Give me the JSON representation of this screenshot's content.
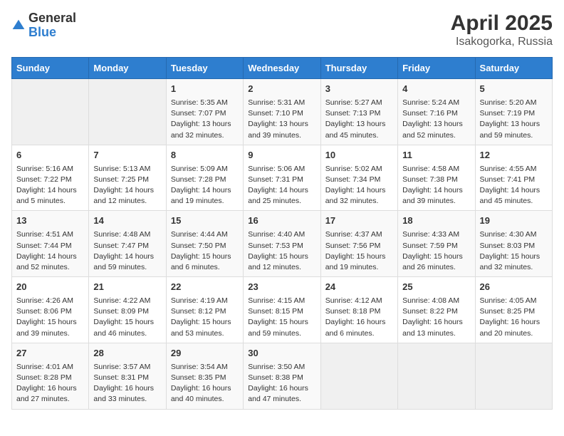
{
  "logo": {
    "general": "General",
    "blue": "Blue"
  },
  "title": {
    "month": "April 2025",
    "location": "Isakogorka, Russia"
  },
  "weekdays": [
    "Sunday",
    "Monday",
    "Tuesday",
    "Wednesday",
    "Thursday",
    "Friday",
    "Saturday"
  ],
  "weeks": [
    [
      null,
      null,
      {
        "day": 1,
        "sunrise": "5:35 AM",
        "sunset": "7:07 PM",
        "daylight": "13 hours and 32 minutes."
      },
      {
        "day": 2,
        "sunrise": "5:31 AM",
        "sunset": "7:10 PM",
        "daylight": "13 hours and 39 minutes."
      },
      {
        "day": 3,
        "sunrise": "5:27 AM",
        "sunset": "7:13 PM",
        "daylight": "13 hours and 45 minutes."
      },
      {
        "day": 4,
        "sunrise": "5:24 AM",
        "sunset": "7:16 PM",
        "daylight": "13 hours and 52 minutes."
      },
      {
        "day": 5,
        "sunrise": "5:20 AM",
        "sunset": "7:19 PM",
        "daylight": "13 hours and 59 minutes."
      }
    ],
    [
      {
        "day": 6,
        "sunrise": "5:16 AM",
        "sunset": "7:22 PM",
        "daylight": "14 hours and 5 minutes."
      },
      {
        "day": 7,
        "sunrise": "5:13 AM",
        "sunset": "7:25 PM",
        "daylight": "14 hours and 12 minutes."
      },
      {
        "day": 8,
        "sunrise": "5:09 AM",
        "sunset": "7:28 PM",
        "daylight": "14 hours and 19 minutes."
      },
      {
        "day": 9,
        "sunrise": "5:06 AM",
        "sunset": "7:31 PM",
        "daylight": "14 hours and 25 minutes."
      },
      {
        "day": 10,
        "sunrise": "5:02 AM",
        "sunset": "7:34 PM",
        "daylight": "14 hours and 32 minutes."
      },
      {
        "day": 11,
        "sunrise": "4:58 AM",
        "sunset": "7:38 PM",
        "daylight": "14 hours and 39 minutes."
      },
      {
        "day": 12,
        "sunrise": "4:55 AM",
        "sunset": "7:41 PM",
        "daylight": "14 hours and 45 minutes."
      }
    ],
    [
      {
        "day": 13,
        "sunrise": "4:51 AM",
        "sunset": "7:44 PM",
        "daylight": "14 hours and 52 minutes."
      },
      {
        "day": 14,
        "sunrise": "4:48 AM",
        "sunset": "7:47 PM",
        "daylight": "14 hours and 59 minutes."
      },
      {
        "day": 15,
        "sunrise": "4:44 AM",
        "sunset": "7:50 PM",
        "daylight": "15 hours and 6 minutes."
      },
      {
        "day": 16,
        "sunrise": "4:40 AM",
        "sunset": "7:53 PM",
        "daylight": "15 hours and 12 minutes."
      },
      {
        "day": 17,
        "sunrise": "4:37 AM",
        "sunset": "7:56 PM",
        "daylight": "15 hours and 19 minutes."
      },
      {
        "day": 18,
        "sunrise": "4:33 AM",
        "sunset": "7:59 PM",
        "daylight": "15 hours and 26 minutes."
      },
      {
        "day": 19,
        "sunrise": "4:30 AM",
        "sunset": "8:03 PM",
        "daylight": "15 hours and 32 minutes."
      }
    ],
    [
      {
        "day": 20,
        "sunrise": "4:26 AM",
        "sunset": "8:06 PM",
        "daylight": "15 hours and 39 minutes."
      },
      {
        "day": 21,
        "sunrise": "4:22 AM",
        "sunset": "8:09 PM",
        "daylight": "15 hours and 46 minutes."
      },
      {
        "day": 22,
        "sunrise": "4:19 AM",
        "sunset": "8:12 PM",
        "daylight": "15 hours and 53 minutes."
      },
      {
        "day": 23,
        "sunrise": "4:15 AM",
        "sunset": "8:15 PM",
        "daylight": "15 hours and 59 minutes."
      },
      {
        "day": 24,
        "sunrise": "4:12 AM",
        "sunset": "8:18 PM",
        "daylight": "16 hours and 6 minutes."
      },
      {
        "day": 25,
        "sunrise": "4:08 AM",
        "sunset": "8:22 PM",
        "daylight": "16 hours and 13 minutes."
      },
      {
        "day": 26,
        "sunrise": "4:05 AM",
        "sunset": "8:25 PM",
        "daylight": "16 hours and 20 minutes."
      }
    ],
    [
      {
        "day": 27,
        "sunrise": "4:01 AM",
        "sunset": "8:28 PM",
        "daylight": "16 hours and 27 minutes."
      },
      {
        "day": 28,
        "sunrise": "3:57 AM",
        "sunset": "8:31 PM",
        "daylight": "16 hours and 33 minutes."
      },
      {
        "day": 29,
        "sunrise": "3:54 AM",
        "sunset": "8:35 PM",
        "daylight": "16 hours and 40 minutes."
      },
      {
        "day": 30,
        "sunrise": "3:50 AM",
        "sunset": "8:38 PM",
        "daylight": "16 hours and 47 minutes."
      },
      null,
      null,
      null
    ]
  ],
  "labels": {
    "sunrise_prefix": "Sunrise: ",
    "sunset_prefix": "Sunset: ",
    "daylight_prefix": "Daylight: "
  }
}
